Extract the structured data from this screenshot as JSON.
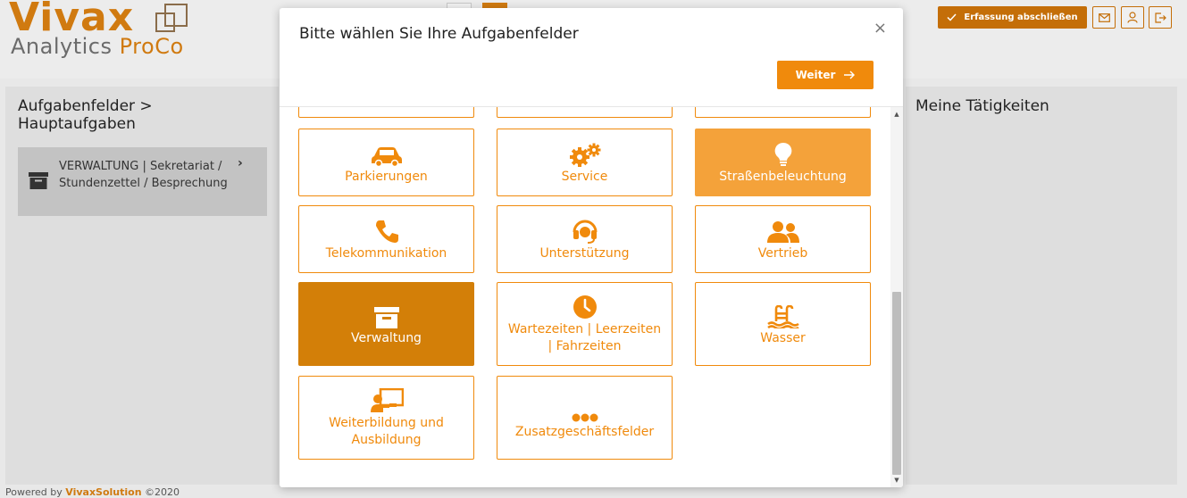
{
  "app": {
    "logo_main": "Vivax",
    "logo_sub": "Analytics",
    "logo_sub_accent": "ProCo",
    "finish_label": "Erfassung abschließen",
    "icons": [
      "mail-icon",
      "user-icon",
      "logout-icon"
    ]
  },
  "left_panel": {
    "title": "Aufgabenfelder > Hauptaufgaben",
    "crumb_text": "VERWALTUNG | Sekretariat / Stundenzettel / Besprechung"
  },
  "right_panel": {
    "title": "Meine Tätigkeiten"
  },
  "footer": {
    "prefix": "Powered by ",
    "brand": "VivaxSolution",
    "suffix": " ©2020"
  },
  "modal": {
    "title": "Bitte wählen Sie Ihre Aufgabenfelder",
    "close_symbol": "×",
    "next_label": "Weiter",
    "tiles": [
      {
        "label": "Parkierungen",
        "icon": "car-icon",
        "state": "normal"
      },
      {
        "label": "Service",
        "icon": "gears-icon",
        "state": "normal"
      },
      {
        "label": "Straßenbeleuchtung",
        "icon": "lightbulb-icon",
        "state": "highlight"
      },
      {
        "label": "Telekommunikation",
        "icon": "phone-icon",
        "state": "normal"
      },
      {
        "label": "Unterstützung",
        "icon": "headset-icon",
        "state": "normal"
      },
      {
        "label": "Vertrieb",
        "icon": "users-icon",
        "state": "normal"
      },
      {
        "label": "Verwaltung",
        "icon": "archive-box-icon",
        "state": "selected"
      },
      {
        "label": "Wartezeiten | Leerzeiten | Fahrzeiten",
        "icon": "clock-icon",
        "state": "normal"
      },
      {
        "label": "Wasser",
        "icon": "pool-icon",
        "state": "normal"
      },
      {
        "label": "Weiterbildung und Ausbildung",
        "icon": "teacher-icon",
        "state": "normal"
      },
      {
        "label": "Zusatzgeschäftsfelder",
        "icon": "dots-icon",
        "state": "normal"
      }
    ]
  },
  "colors": {
    "accent": "#f08a0c",
    "selected": "#d37f08",
    "highlight": "#f4a23a",
    "brand": "#d07a10"
  }
}
